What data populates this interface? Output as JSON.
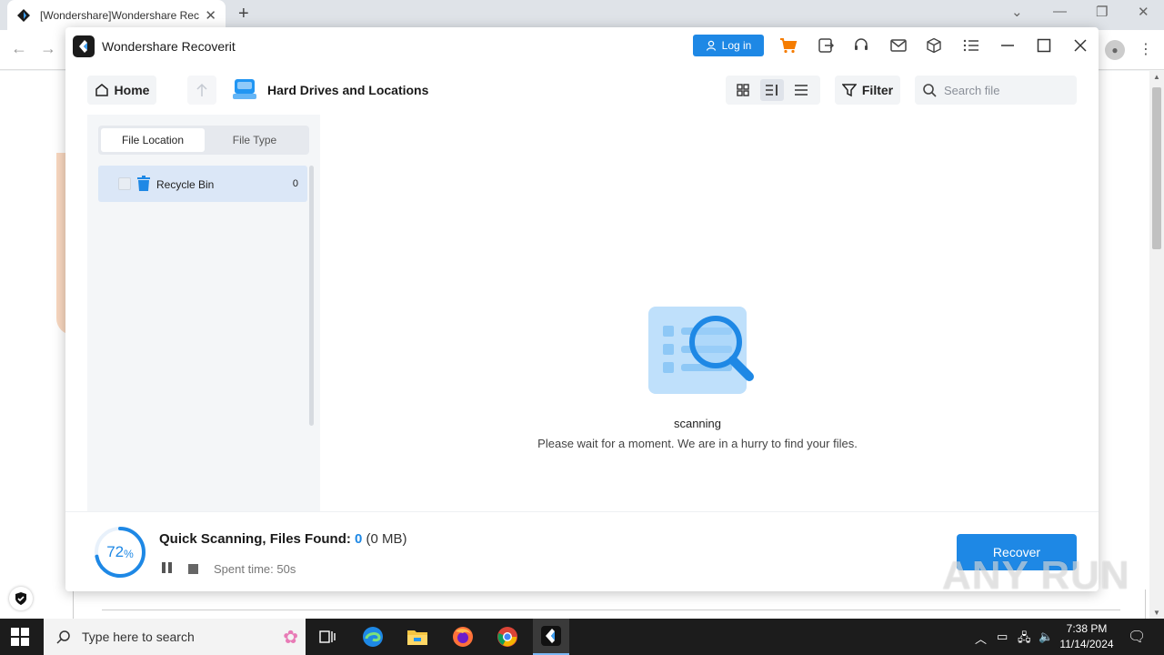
{
  "browser": {
    "tab_title": "[Wondershare]Wondershare Rec",
    "new_tab": "+",
    "tab_close": "✕"
  },
  "app": {
    "name": "Wondershare Recoverit",
    "login_label": "Log in",
    "toolbar": {
      "home_label": "Home",
      "location_title": "Hard Drives and Locations",
      "filter_label": "Filter",
      "search_placeholder": "Search file"
    },
    "sidebar": {
      "tabs": [
        {
          "label": "File Location",
          "active": true
        },
        {
          "label": "File Type",
          "active": false
        }
      ],
      "items": [
        {
          "label": "Recycle Bin",
          "count": "0"
        }
      ]
    },
    "main": {
      "status_title": "scanning",
      "status_message": "Please wait for a moment. We are in a hurry to find your files."
    },
    "footer": {
      "progress_percent": 72,
      "progress_value": "72",
      "progress_unit": "%",
      "status_prefix": "Quick Scanning, Files Found:",
      "files_found": "0",
      "size": "(0 MB)",
      "spent_time": "Spent time: 50s",
      "recover_label": "Recover"
    }
  },
  "watermark": "ANY RUN",
  "taskbar": {
    "search_placeholder": "Type here to search",
    "time": "7:38 PM",
    "date": "11/14/2024"
  },
  "colors": {
    "accent": "#1e88e5",
    "selected_row": "#dbe7f7",
    "taskbar": "#1c1c1c"
  }
}
